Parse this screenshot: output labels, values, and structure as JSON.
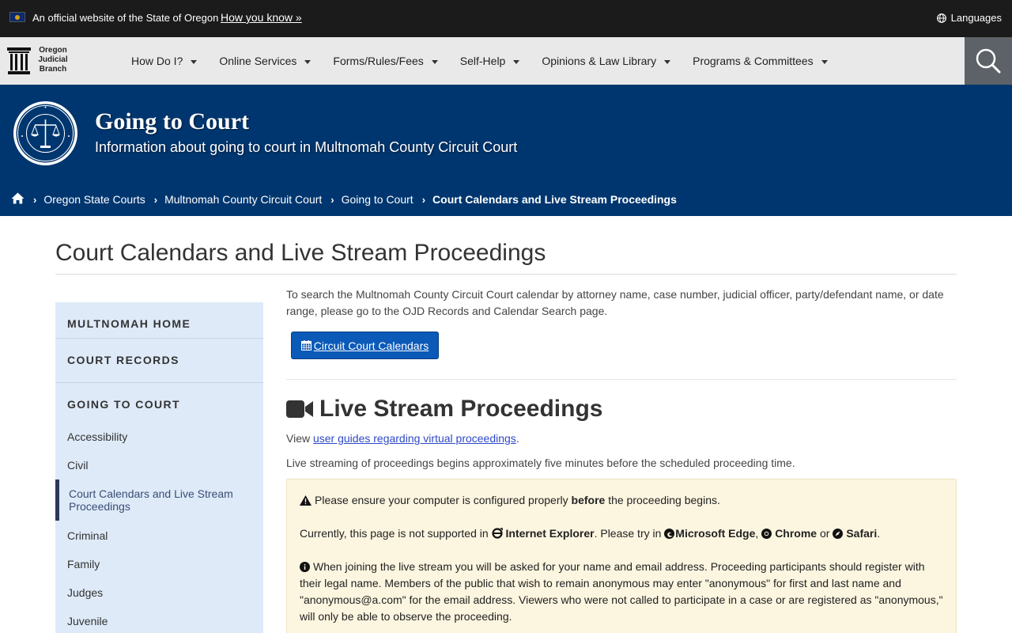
{
  "gov_banner": {
    "text": "An official website of the State of Oregon",
    "link": "How you know »",
    "languages": "Languages"
  },
  "logo": {
    "line1": "Oregon",
    "line2": "Judicial",
    "line3": "Branch"
  },
  "nav": {
    "items": [
      {
        "label": "How Do I?"
      },
      {
        "label": "Online Services"
      },
      {
        "label": "Forms/Rules/Fees"
      },
      {
        "label": "Self-Help"
      },
      {
        "label": "Opinions & Law Library"
      },
      {
        "label": "Programs & Committees"
      }
    ]
  },
  "hero": {
    "title": "Going to Court",
    "subtitle": "Information about going to court in Multnomah County Circuit Court"
  },
  "breadcrumbs": {
    "items": [
      {
        "label": "Oregon State Courts"
      },
      {
        "label": "Multnomah County Circuit Court"
      },
      {
        "label": "Going to Court"
      },
      {
        "label": "Court Calendars and Live Stream Proceedings"
      }
    ]
  },
  "page": {
    "title": "Court Calendars and Live Stream Proceedings"
  },
  "sidenav": {
    "headers": [
      "MULTNOMAH HOME",
      "COURT RECORDS",
      "GOING TO COURT"
    ],
    "links": [
      "Accessibility",
      "Civil",
      "Criminal",
      "Family",
      "Judges",
      "Juvenile"
    ],
    "active": "Court Calendars and Live Stream Proceedings"
  },
  "content": {
    "intro": "To search the Multnomah County Circuit Court calendar by attorney name, case number, judicial officer, party/defendant name, or date range, please go to the OJD Records and Calendar Search page.",
    "calendar_button": "Circuit Court Calendars",
    "live_heading": "Live Stream Proceedings",
    "view_prefix": "View ",
    "view_link": "user guides regarding virtual proceedings",
    "view_suffix": ".",
    "stream_note": "Live streaming of proceedings begins approximately five minutes before the scheduled proceeding time."
  },
  "alert": {
    "p1_a": "Please ensure your computer is configured properly ",
    "p1_b": "before",
    "p1_c": " the proceeding begins.",
    "p2_a": "Currently, this page is not supported in ",
    "p2_ie": "Internet Explorer",
    "p2_b": ". Please try in ",
    "p2_edge": "Microsoft Edge",
    "p2_comma": ", ",
    "p2_chrome": "Chrome",
    "p2_or": " or ",
    "p2_safari": "Safari",
    "p2_end": ".",
    "p3": "When joining the live stream you will be asked for your name and email address. Proceeding participants should register with their legal name. Members of the public that wish to remain anonymous may enter \"anonymous\" for first and last name and \"anonymous@a.com\" for the email address. Viewers who were not called to participate in a case or are registered as \"anonymous,\" will only be able to observe the proceeding."
  },
  "colors": {
    "banner": "#1b1b1b",
    "nav_bg": "#e9e9e9",
    "hero_bg": "#00366f",
    "sidenav_bg": "#deeaf8",
    "button": "#0b5ab8",
    "alert_bg": "#fcf5e0",
    "link": "#2e48c7"
  }
}
